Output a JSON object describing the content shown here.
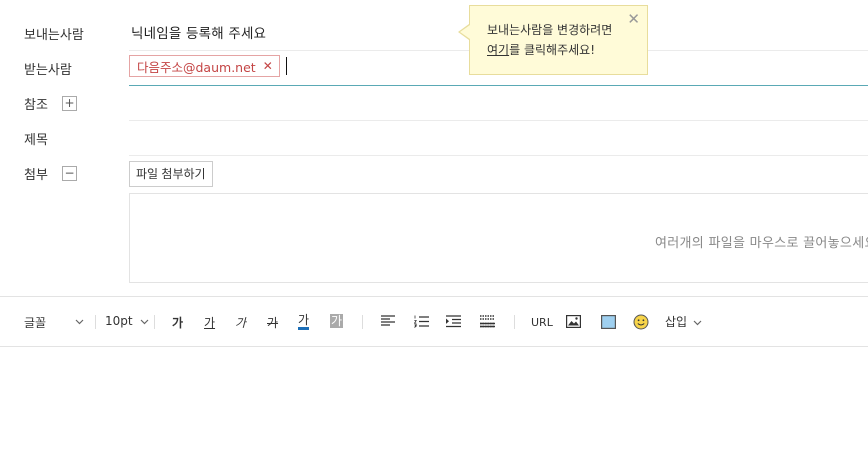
{
  "fields": {
    "sender_label": "보내는사람",
    "sender_value": "닉네임을 등록해 주세요",
    "to_label": "받는사람",
    "to_chip": "다음주소@daum.net",
    "cc_label": "참조",
    "subject_label": "제목",
    "attach_label": "첨부"
  },
  "tooltip": {
    "line1": "보내는사람을 변경하려면",
    "link": "여기",
    "line2_rest": "를 클릭해주세요!"
  },
  "attachment": {
    "button_label": "파일 첨부하기",
    "drop_text": "여러개의 파일을 마우스로 끌어놓으세요"
  },
  "toolbar": {
    "font_label": "글꼴",
    "size_label": "10pt",
    "bold": "가",
    "underline": "가",
    "italic": "가",
    "strike": "가",
    "font_color": "가",
    "bg_color": "가",
    "url": "URL",
    "insert_label": "삽입"
  },
  "colors": {
    "chip_text": "#c44545",
    "active_underline": "#5aa9b5",
    "tooltip_bg": "#fffbd8",
    "font_color_bar": "#1c6fb8"
  }
}
